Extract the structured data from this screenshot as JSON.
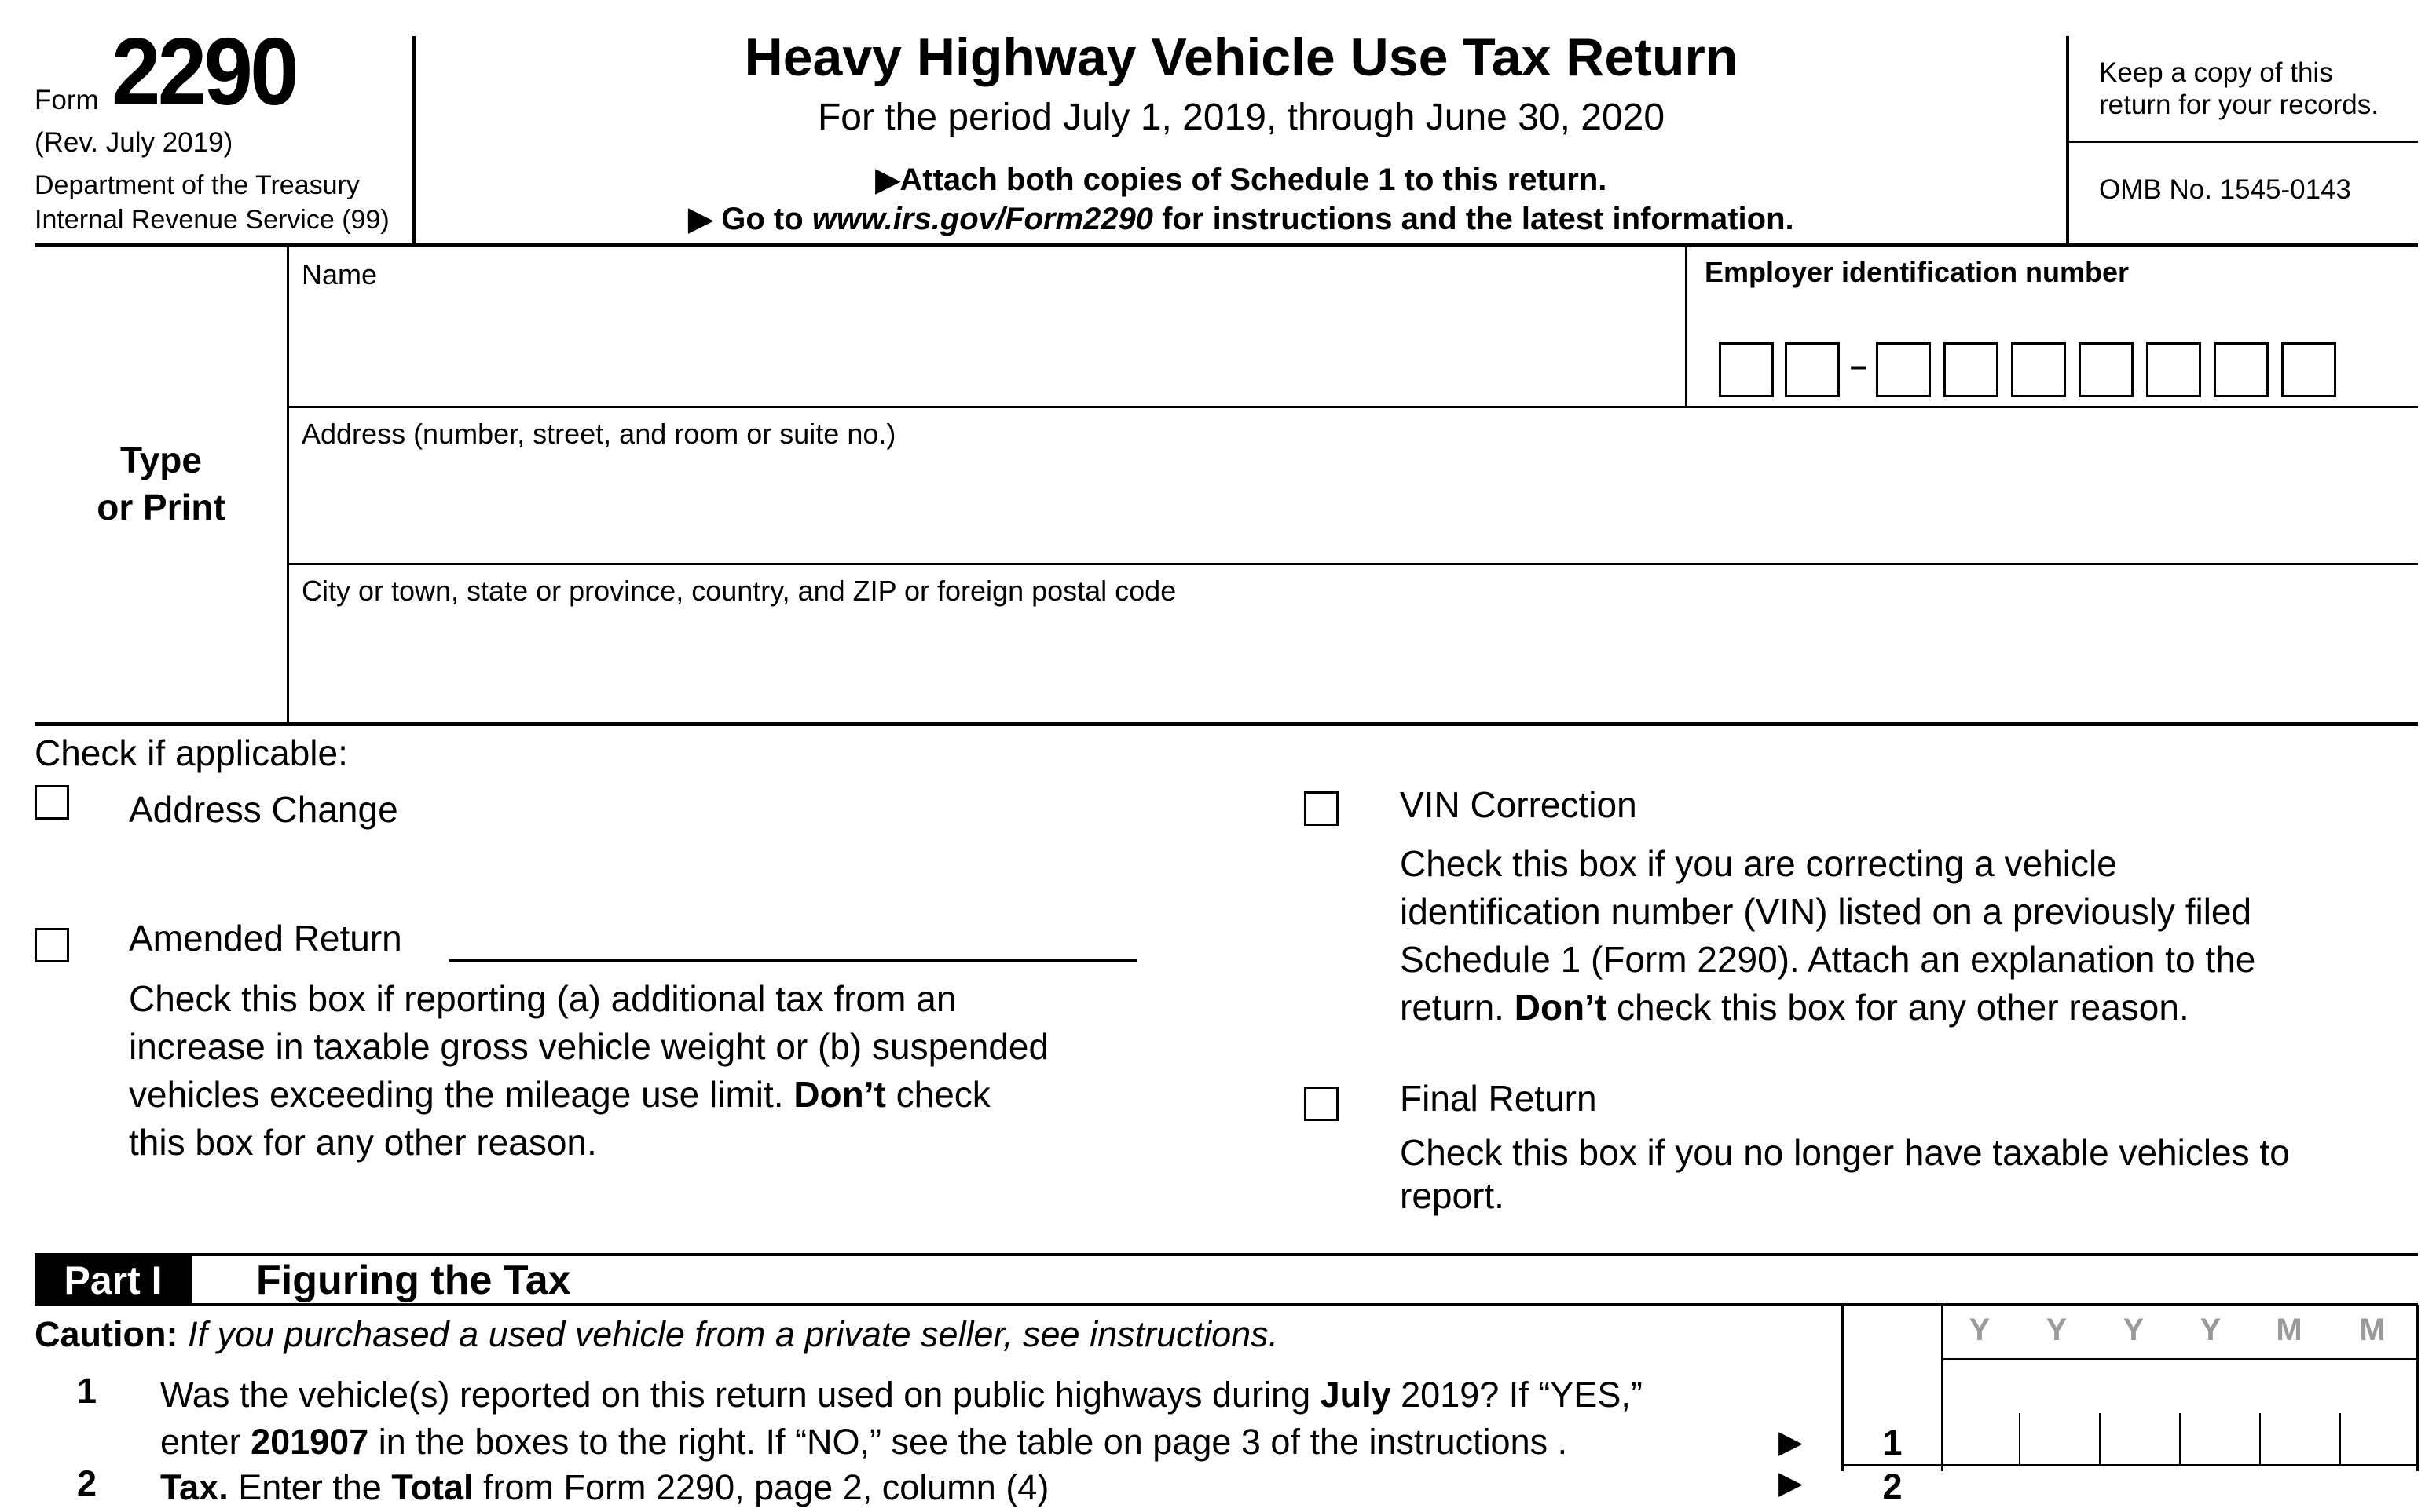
{
  "header": {
    "form_word": "Form",
    "form_number": "2290",
    "revision": "(Rev. July 2019)",
    "department": "Department of the Treasury",
    "agency": "Internal Revenue Service (99)",
    "title": "Heavy Highway Vehicle Use Tax Return",
    "subtitle": "For the period July 1, 2019, through June 30, 2020",
    "note_attach": "Attach both copies of Schedule 1 to this return.",
    "note_goto_prefix": "Go to ",
    "note_goto_url": "www.irs.gov/Form2290",
    "note_goto_suffix": " for instructions and the latest information.",
    "arrow_icon": "▶",
    "keep_copy_line1": "Keep a copy of this",
    "keep_copy_line2": "return for your records.",
    "omb": "OMB No. 1545-0143"
  },
  "identity": {
    "side_label_line1": "Type",
    "side_label_line2": "or Print",
    "name_label": "Name",
    "name_value": "",
    "ein_label": "Employer identification number",
    "ein_digits": [
      "",
      "",
      "",
      "",
      "",
      "",
      "",
      "",
      ""
    ],
    "ein_dash": "–",
    "address_label": "Address (number, street, and room or suite no.)",
    "address_value": "",
    "city_label": "City or town, state or province, country, and ZIP or foreign postal code",
    "city_value": ""
  },
  "check_section": {
    "heading": "Check if applicable:",
    "address_change": {
      "label": "Address Change",
      "checked": false
    },
    "amended_return": {
      "label": "Amended Return",
      "line_value": "",
      "desc_lines": [
        "Check this box if reporting (a) additional tax from an",
        "increase in taxable gross vehicle weight or (b) suspended",
        "vehicles exceeding the mileage use limit. ",
        "this box for any other reason."
      ],
      "desc_bold": "Don’t",
      "desc_after_bold": " check",
      "checked": false
    },
    "vin_correction": {
      "label": "VIN Correction",
      "desc_lines": [
        "Check this box if you are correcting a vehicle",
        "identification number (VIN) listed on a previously filed",
        "Schedule 1 (Form 2290). Attach an explanation to the",
        "return. "
      ],
      "desc_bold": "Don’t",
      "desc_after_bold": " check this box for any other reason.",
      "checked": false
    },
    "final_return": {
      "label": "Final Return",
      "desc_lines": [
        "Check this box if you no longer have taxable vehicles to",
        "report."
      ],
      "checked": false
    }
  },
  "part1": {
    "part_label": "Part I",
    "title": "Figuring the Tax",
    "caution_bold": "Caution:",
    "caution_text": " If you purchased a used vehicle from a private seller, see instructions.",
    "date_header": [
      "Y",
      "Y",
      "Y",
      "Y",
      "M",
      "M"
    ],
    "lines": [
      {
        "number": "1",
        "text1_a": "Was the vehicle(s) reported on this return used on public highways during ",
        "text1_bold": "July",
        "text1_b": " 2019? If “YES,”",
        "text2_a": "enter ",
        "text2_bold": "201907",
        "text2_b": " in the boxes to the right. If “NO,” see the table on page 3 of the instructions .",
        "value": ""
      },
      {
        "number": "2",
        "text_bold_a": "Tax.",
        "text_a": " Enter the ",
        "text_bold_b": "Total",
        "text_b": " from Form 2290, page 2, column (4)",
        "value": ""
      }
    ]
  }
}
